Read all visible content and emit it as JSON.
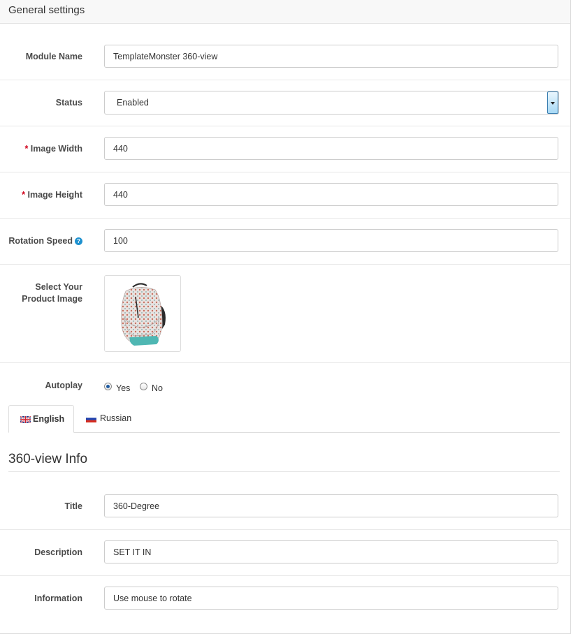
{
  "panel": {
    "title": "General settings"
  },
  "fields": {
    "module_name": {
      "label": "Module Name",
      "value": "TemplateMonster 360-view"
    },
    "status": {
      "label": "Status",
      "value": "Enabled"
    },
    "image_width": {
      "required_mark": "*",
      "label": "Image Width",
      "value": "440"
    },
    "image_height": {
      "required_mark": "*",
      "label": "Image Height",
      "value": "440"
    },
    "rotation_speed": {
      "label": "Rotation Speed",
      "value": "100",
      "help_icon": "question-circle-icon"
    },
    "product_image": {
      "label_line1": "Select Your",
      "label_line2": "Product Image",
      "image_alt": "backpack"
    },
    "autoplay": {
      "label": "Autoplay",
      "options": [
        "Yes",
        "No"
      ],
      "selected": "Yes"
    }
  },
  "tabs": [
    {
      "label": "English",
      "flag_icon": "uk-flag-icon",
      "active": true
    },
    {
      "label": "Russian",
      "flag_icon": "russia-flag-icon",
      "active": false
    }
  ],
  "info_section": {
    "heading": "360-view Info",
    "title": {
      "label": "Title",
      "value": "360-Degree"
    },
    "description": {
      "label": "Description",
      "value": "SET IT IN"
    },
    "information": {
      "label": "Information",
      "value": "Use mouse to rotate"
    }
  },
  "colors": {
    "accent": "#1e91cf",
    "required": "#d0021b",
    "border": "#cccccc",
    "heading_bg": "#f8f8f8"
  }
}
